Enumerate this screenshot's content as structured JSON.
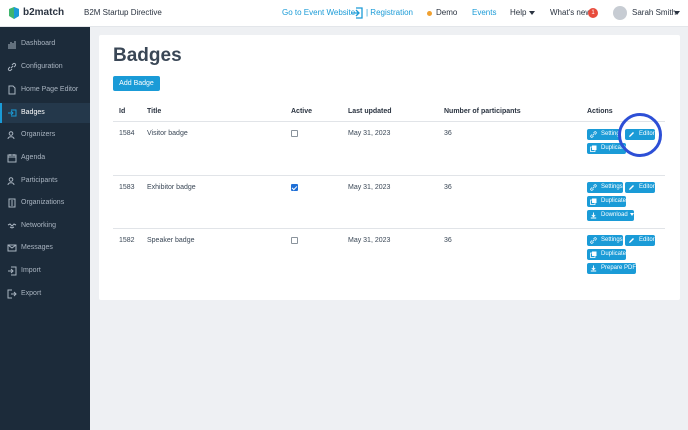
{
  "header": {
    "brand": "b2match",
    "event_title": "B2M Startup Directive",
    "goto_website": "Go to Event Website",
    "registration": "| Registration",
    "demo": "Demo",
    "events": "Events",
    "help": "Help",
    "whats_new": "What's new",
    "whats_new_count": "1",
    "user_name": "Sarah Smith"
  },
  "sidebar": {
    "items": [
      {
        "label": "Dashboard",
        "icon": "chart-icon"
      },
      {
        "label": "Configuration",
        "icon": "link-icon"
      },
      {
        "label": "Home Page Editor",
        "icon": "document-icon"
      },
      {
        "label": "Badges",
        "icon": "badge-icon",
        "active": true
      },
      {
        "label": "Organizers",
        "icon": "people-icon"
      },
      {
        "label": "Agenda",
        "icon": "calendar-icon"
      },
      {
        "label": "Participants",
        "icon": "people-icon"
      },
      {
        "label": "Organizations",
        "icon": "building-icon"
      },
      {
        "label": "Networking",
        "icon": "handshake-icon"
      },
      {
        "label": "Messages",
        "icon": "envelope-icon"
      },
      {
        "label": "Import",
        "icon": "import-icon"
      },
      {
        "label": "Export",
        "icon": "export-icon"
      }
    ]
  },
  "main": {
    "title": "Badges",
    "add_button": "Add Badge",
    "columns": [
      "Id",
      "Title",
      "Active",
      "Last updated",
      "Number of participants",
      "Actions"
    ],
    "rows": [
      {
        "id": "1584",
        "title": "Visitor badge",
        "active": false,
        "updated": "May 31, 2023",
        "participants": "36",
        "actions": [
          "Setting",
          "Editor",
          "Duplicate"
        ]
      },
      {
        "id": "1583",
        "title": "Exhibitor badge",
        "active": true,
        "updated": "May 31, 2023",
        "participants": "36",
        "actions": [
          "Settings",
          "Editor",
          "Duplicate",
          "Download"
        ]
      },
      {
        "id": "1582",
        "title": "Speaker badge",
        "active": false,
        "updated": "May 31, 2023",
        "participants": "36",
        "actions": [
          "Settings",
          "Editor",
          "Duplicate",
          "Prepare PDF"
        ]
      }
    ]
  },
  "colors": {
    "accent": "#1a9bd7",
    "sidebar_bg": "#1c2b3a",
    "highlight_ring": "#2d4fd6",
    "notification": "#e84b3c"
  }
}
